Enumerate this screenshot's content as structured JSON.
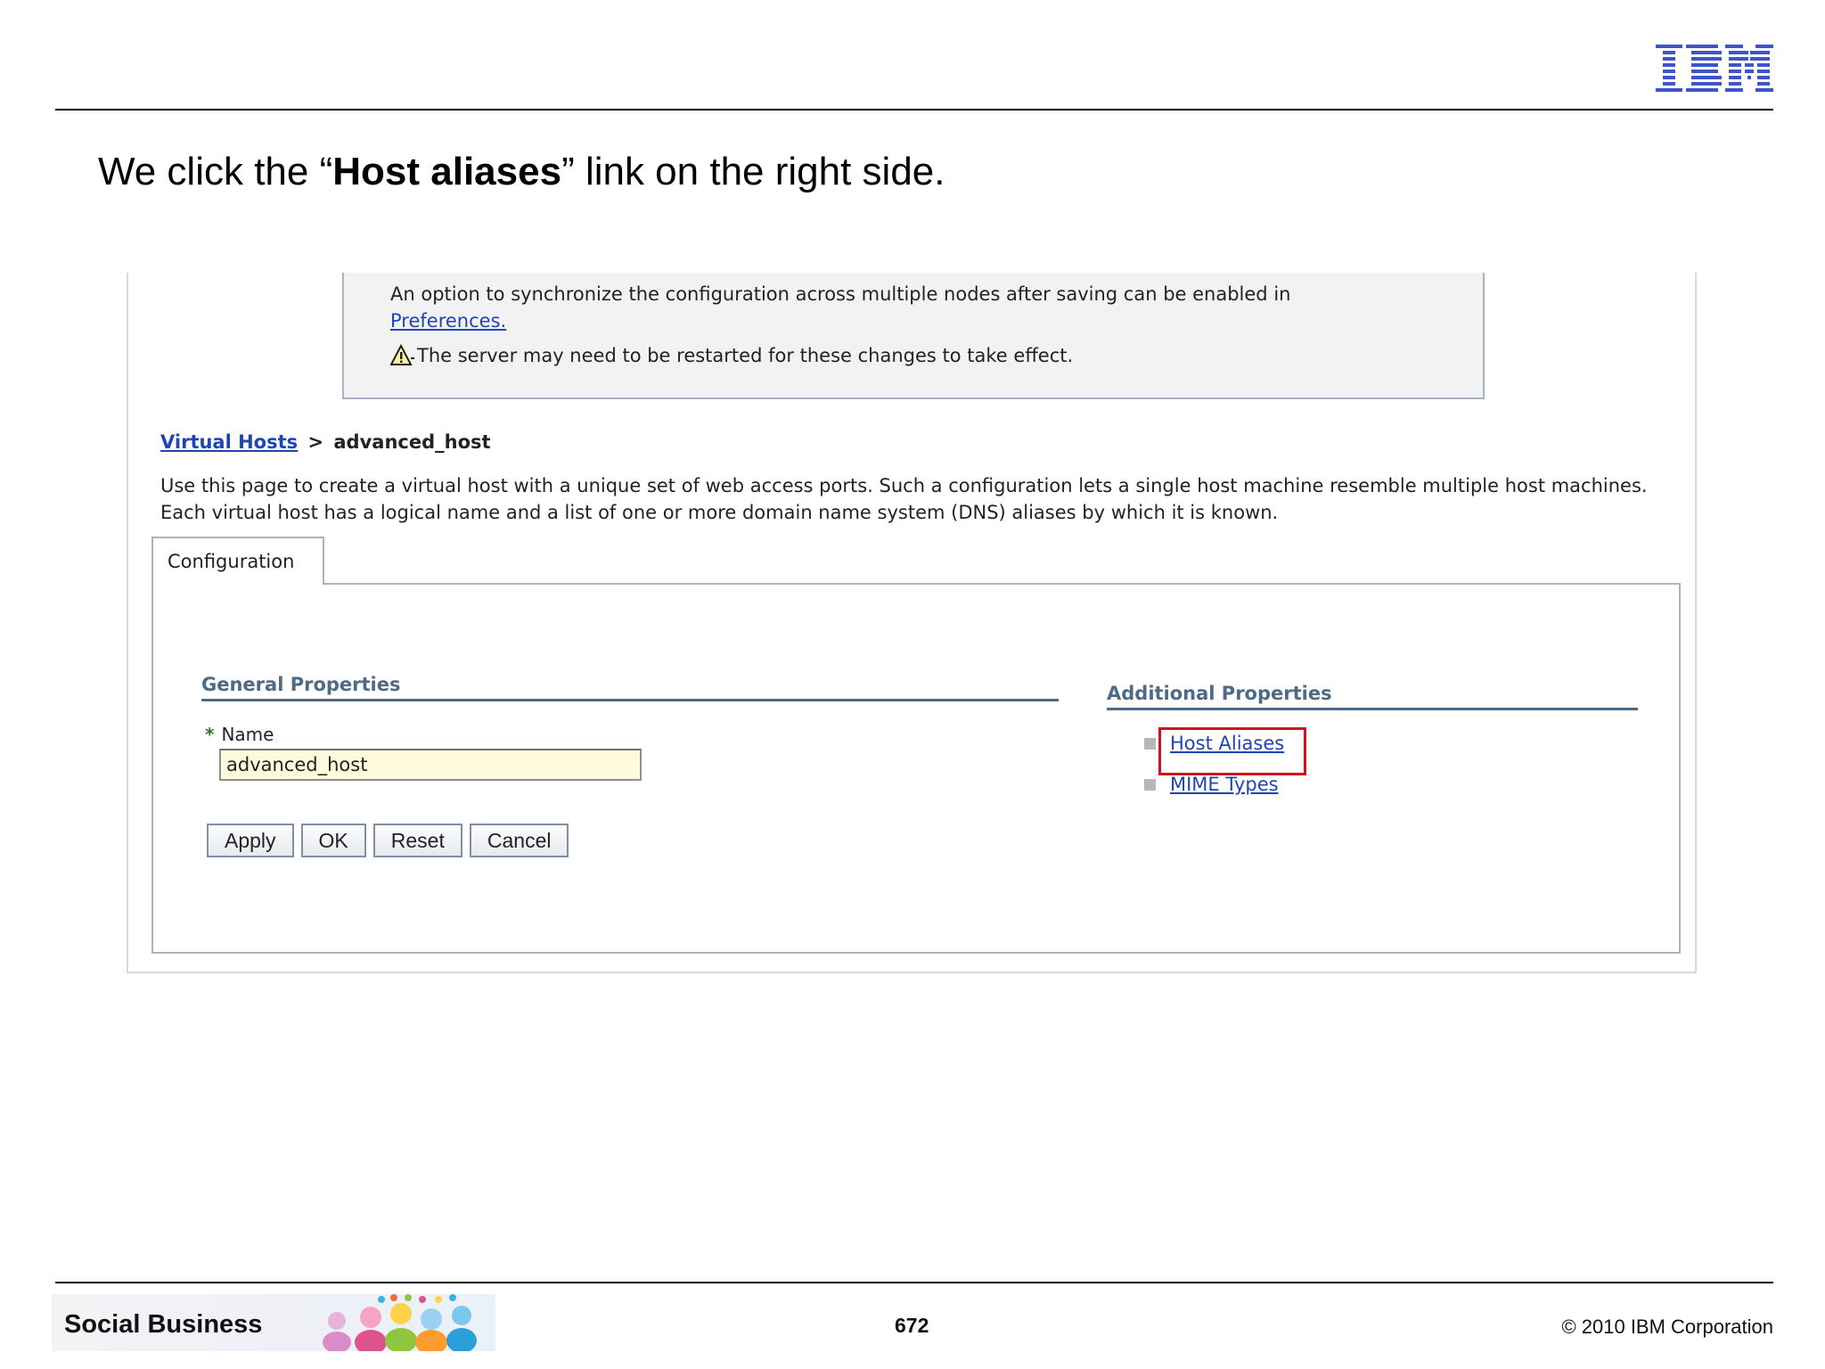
{
  "header": {
    "logo_text": "IBM",
    "title_prefix": "We click the “",
    "title_bold": "Host aliases",
    "title_suffix": "” link on the right side."
  },
  "screenshot": {
    "message": {
      "line1": "An option to synchronize the configuration across multiple nodes after saving can be enabled in",
      "preferences_link": "Preferences.",
      "warning": "The server may need to be restarted for these changes to take effect."
    },
    "breadcrumb": {
      "link": "Virtual Hosts",
      "separator": ">",
      "current": "advanced_host"
    },
    "description": "Use this page to create a virtual host with a unique set of web access ports. Such a configuration lets a single host machine resemble multiple host machines. Each virtual host has a logical name and a list of one or more domain name system (DNS) aliases by which it is known.",
    "tab_label": "Configuration",
    "general_properties": {
      "title": "General Properties",
      "required_mark": "*",
      "name_label": "Name",
      "name_value": "advanced_host"
    },
    "buttons": {
      "apply": "Apply",
      "ok": "OK",
      "reset": "Reset",
      "cancel": "Cancel"
    },
    "additional_properties": {
      "title": "Additional Properties",
      "items": [
        "Host Aliases",
        "MIME Types"
      ]
    },
    "highlight_color": "#d2121f",
    "link_color": "#1f44b8"
  },
  "footer": {
    "brand": "Social Business",
    "page_number": "672",
    "copyright": "© 2010 IBM Corporation"
  }
}
